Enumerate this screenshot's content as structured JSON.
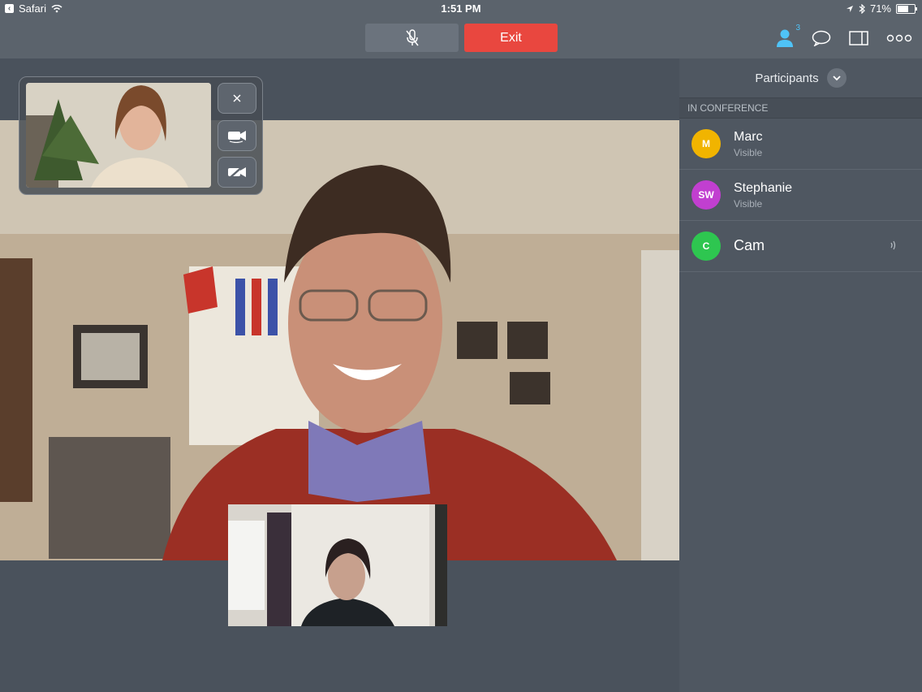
{
  "status_bar": {
    "app": "Safari",
    "time": "1:51 PM",
    "battery": "71%",
    "battery_level": 0.71
  },
  "toolbar": {
    "mic_icon": "microphone-muted-icon",
    "exit_label": "Exit",
    "participants_count": "3",
    "icons": [
      "participants-icon",
      "chat-icon",
      "layout-icon",
      "more-icon"
    ],
    "exit_color": "#e9473f"
  },
  "sidebar": {
    "title": "Participants",
    "section_label": "IN CONFERENCE",
    "participants": [
      {
        "initials": "M",
        "name": "Marc",
        "status": "Visible",
        "color": "#f1b400"
      },
      {
        "initials": "SW",
        "name": "Stephanie",
        "status": "Visible",
        "color": "#c13fd0"
      },
      {
        "initials": "C",
        "name": "Cam",
        "status": "",
        "color": "#2ec650",
        "speaking": true
      }
    ]
  },
  "self_view_controls": [
    "close-icon",
    "switch-camera-icon",
    "camera-off-icon"
  ]
}
